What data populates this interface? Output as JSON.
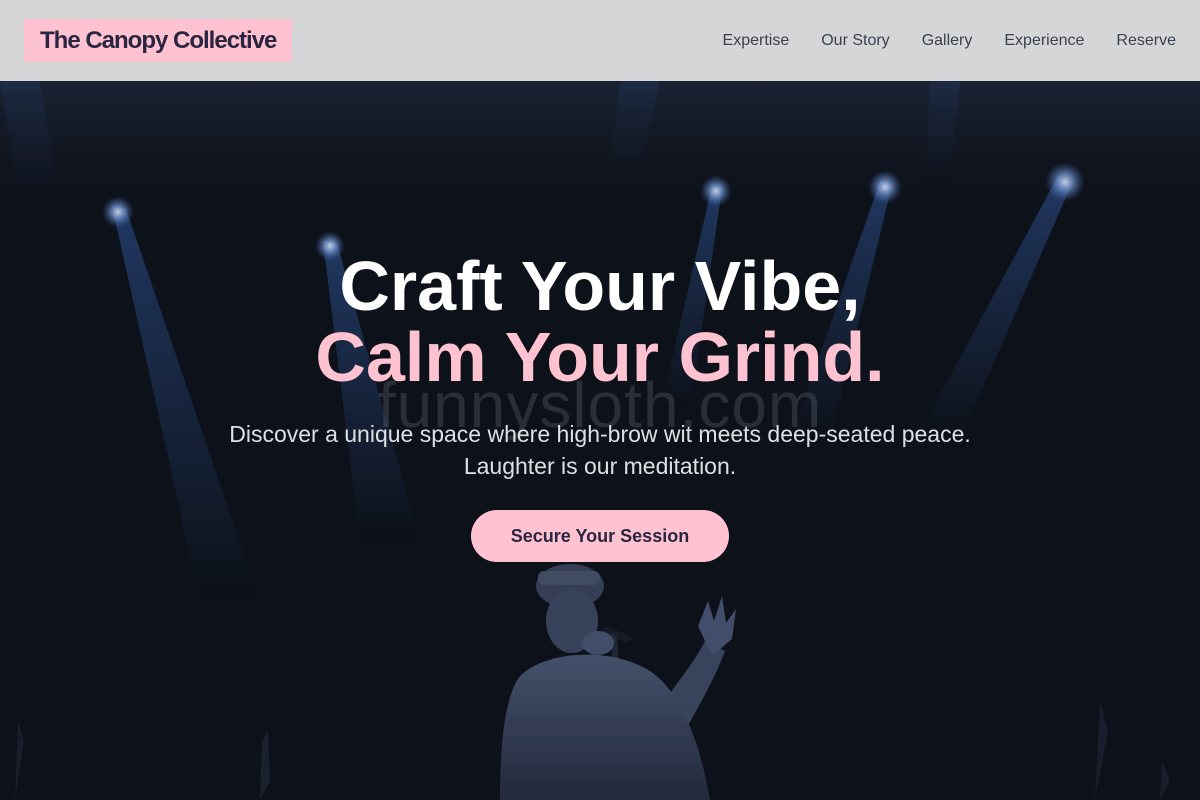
{
  "header": {
    "brand": "The Canopy Collective",
    "nav": [
      "Expertise",
      "Our Story",
      "Gallery",
      "Experience",
      "Reserve"
    ]
  },
  "hero": {
    "headline_line1": "Craft Your Vibe,",
    "headline_line2": "Calm Your Grind.",
    "watermark": "funnysloth.com",
    "subtext_line1": "Discover a unique space where high-brow wit meets deep-seated peace.",
    "subtext_line2": "Laughter is our meditation.",
    "cta_label": "Secure Your Session"
  },
  "colors": {
    "accent_pink": "#ffc2d1",
    "header_bg": "#d6d6d9",
    "hero_bg": "#0e1119",
    "brand_text": "#2a2540",
    "spotlight_blue": "#3d6fc7"
  }
}
